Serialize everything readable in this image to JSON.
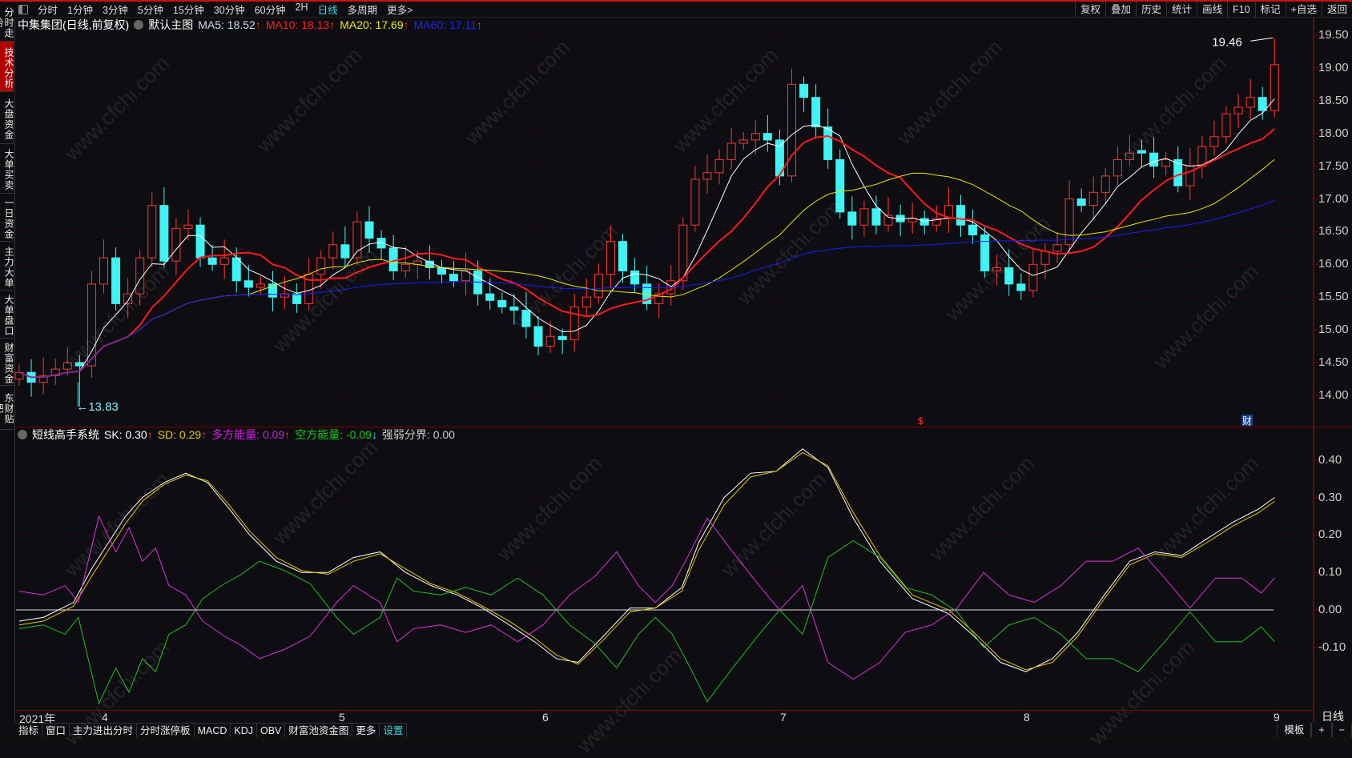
{
  "sidebar": {
    "items": [
      "分时走势",
      "技术分析",
      "大盘资金",
      "大单买卖",
      "一日资金",
      "主力大单",
      "大单盘口",
      "财富资金",
      "东财贴吧"
    ],
    "active": 1
  },
  "toolbar": {
    "periods": [
      "分时",
      "1分钟",
      "3分钟",
      "5分钟",
      "15分钟",
      "30分钟",
      "60分钟",
      "2H",
      "日线",
      "多周期",
      "更多>"
    ],
    "active": "日线",
    "right": [
      "复权",
      "叠加",
      "历史",
      "统计",
      "画线",
      "F10",
      "标记",
      "+自选",
      "返回"
    ]
  },
  "info": {
    "stock": "中集集团(日线,前复权)",
    "template": "默认主图",
    "ma5": "MA5: 18.52",
    "ma10": "MA10: 18.13",
    "ma20": "MA20: 17.69",
    "ma60": "MA60: 17.11",
    "arrow_up": "↑"
  },
  "indicator": {
    "name": "短线高手系统",
    "sk": "SK: 0.30",
    "sd": "SD: 0.29",
    "bull": "多方能量: 0.09",
    "bear": "空方能量: -0.09",
    "line": "强弱分界: 0.00",
    "up": "↑",
    "down": "↓"
  },
  "markers": {
    "high": "19.46",
    "low": "13.83",
    "dollar": "$",
    "cai": "财"
  },
  "watermark": "www.cfchi.com",
  "dates": {
    "year": "2021年",
    "months": [
      "4",
      "5",
      "6",
      "7",
      "8",
      "9"
    ]
  },
  "period_box": "日线",
  "bottom_tabs": [
    "指标",
    "窗口",
    "主力进出分时",
    "分时涨停板",
    "MACD",
    "KDJ",
    "OBV",
    "财富池资金图",
    "更多",
    "设置"
  ],
  "bottom_right": [
    "模板",
    "+",
    "−"
  ],
  "colors": {
    "up": "#ff3333",
    "down": "#3ef4f4",
    "ma5": "#ffffff",
    "ma10": "#ff1a1a",
    "ma20": "#e6e600",
    "ma60": "#1a1aff",
    "sk": "#ffffff",
    "sd": "#e6c800",
    "bull": "#e030e0",
    "bear": "#20c020"
  },
  "chart_data": [
    {
      "type": "candlestick",
      "title": "中集集团 日线",
      "ylim": [
        13.8,
        19.6
      ],
      "yticks": [
        "19.50",
        "19.00",
        "18.50",
        "18.00",
        "17.50",
        "17.00",
        "16.50",
        "16.00",
        "15.50",
        "15.00",
        "14.50",
        "14.00"
      ],
      "first_open": 14.25,
      "high_value": 19.46,
      "low_value": 13.83,
      "close": [
        14.35,
        14.2,
        14.3,
        14.4,
        14.5,
        14.45,
        15.7,
        16.1,
        15.4,
        15.55,
        16.1,
        16.9,
        16.05,
        16.55,
        16.6,
        16.1,
        16.0,
        16.1,
        15.75,
        15.65,
        15.7,
        15.5,
        15.55,
        15.4,
        15.85,
        16.1,
        16.3,
        16.1,
        16.65,
        16.4,
        16.25,
        15.9,
        16.0,
        16.05,
        15.95,
        15.85,
        15.75,
        15.9,
        15.55,
        15.45,
        15.35,
        15.3,
        15.05,
        14.75,
        14.9,
        14.85,
        15.35,
        15.5,
        15.85,
        16.35,
        15.9,
        15.7,
        15.4,
        15.55,
        15.75,
        16.6,
        17.3,
        17.4,
        17.6,
        17.85,
        17.9,
        18.0,
        17.9,
        17.35,
        18.75,
        18.55,
        18.1,
        17.6,
        16.8,
        16.6,
        16.85,
        16.6,
        16.75,
        16.65,
        16.7,
        16.6,
        16.7,
        16.9,
        16.6,
        16.45,
        15.9,
        15.95,
        15.7,
        15.6,
        16.0,
        16.2,
        16.3,
        17.0,
        16.9,
        17.1,
        17.35,
        17.6,
        17.7,
        17.7,
        17.5,
        17.6,
        17.2,
        17.5,
        17.8,
        17.95,
        18.3,
        18.4,
        18.55,
        18.35,
        19.05
      ],
      "ma_periods": [
        5,
        10,
        20,
        60
      ]
    },
    {
      "type": "line",
      "title": "短线高手系统",
      "ylim": [
        -0.18,
        0.46
      ],
      "yticks": [
        "0.40",
        "0.30",
        "0.20",
        "0.10",
        "0.00",
        "-0.10"
      ],
      "baseline": 0,
      "series": [
        {
          "name": "SK",
          "points": [
            [
              0,
              -0.03
            ],
            [
              2,
              -0.02
            ],
            [
              4.5,
              0.02
            ],
            [
              6,
              0.11
            ],
            [
              7.4,
              0.18
            ],
            [
              8.8,
              0.25
            ],
            [
              10.2,
              0.3
            ],
            [
              12,
              0.34
            ],
            [
              13.8,
              0.365
            ],
            [
              15.6,
              0.34
            ],
            [
              17.4,
              0.27
            ],
            [
              19.1,
              0.2
            ],
            [
              21.3,
              0.13
            ],
            [
              23.4,
              0.1
            ],
            [
              25.6,
              0.1
            ],
            [
              27.7,
              0.14
            ],
            [
              29.9,
              0.155
            ],
            [
              32,
              0.1
            ],
            [
              34.1,
              0.065
            ],
            [
              36.3,
              0.04
            ],
            [
              38.4,
              0.005
            ],
            [
              40.6,
              -0.04
            ],
            [
              42.7,
              -0.085
            ],
            [
              44.5,
              -0.13
            ],
            [
              46.3,
              -0.14
            ],
            [
              48.4,
              -0.07
            ],
            [
              50.6,
              0.005
            ],
            [
              52.7,
              0.005
            ],
            [
              54.9,
              0.06
            ],
            [
              56.3,
              0.18
            ],
            [
              58.4,
              0.3
            ],
            [
              60.6,
              0.365
            ],
            [
              62.7,
              0.37
            ],
            [
              64.9,
              0.43
            ],
            [
              67,
              0.38
            ],
            [
              69.1,
              0.245
            ],
            [
              71.3,
              0.13
            ],
            [
              74,
              0.03
            ],
            [
              77,
              -0.01
            ],
            [
              79.1,
              -0.07
            ],
            [
              81.3,
              -0.14
            ],
            [
              83.4,
              -0.165
            ],
            [
              85.6,
              -0.13
            ],
            [
              87.7,
              -0.06
            ],
            [
              89.9,
              0.04
            ],
            [
              92,
              0.13
            ],
            [
              94.1,
              0.155
            ],
            [
              96.3,
              0.145
            ],
            [
              98.4,
              0.19
            ],
            [
              100.6,
              0.235
            ],
            [
              102.7,
              0.27
            ],
            [
              104,
              0.3
            ]
          ]
        },
        {
          "name": "SD",
          "points": [
            [
              0,
              -0.04
            ],
            [
              2,
              -0.03
            ],
            [
              4.5,
              0.01
            ],
            [
              6,
              0.09
            ],
            [
              7.4,
              0.16
            ],
            [
              8.8,
              0.23
            ],
            [
              10.2,
              0.29
            ],
            [
              12,
              0.335
            ],
            [
              13.8,
              0.36
            ],
            [
              15.6,
              0.345
            ],
            [
              17.4,
              0.28
            ],
            [
              19.1,
              0.21
            ],
            [
              21.3,
              0.14
            ],
            [
              23.4,
              0.105
            ],
            [
              25.6,
              0.095
            ],
            [
              27.7,
              0.13
            ],
            [
              29.9,
              0.15
            ],
            [
              32,
              0.11
            ],
            [
              34.1,
              0.07
            ],
            [
              36.3,
              0.045
            ],
            [
              38.4,
              0.01
            ],
            [
              40.6,
              -0.03
            ],
            [
              42.7,
              -0.075
            ],
            [
              44.5,
              -0.12
            ],
            [
              46.3,
              -0.145
            ],
            [
              48.4,
              -0.08
            ],
            [
              50.6,
              -0.005
            ],
            [
              52.7,
              0.005
            ],
            [
              54.9,
              0.05
            ],
            [
              56.3,
              0.16
            ],
            [
              58.4,
              0.28
            ],
            [
              60.6,
              0.355
            ],
            [
              62.7,
              0.37
            ],
            [
              64.9,
              0.42
            ],
            [
              67,
              0.385
            ],
            [
              69.1,
              0.26
            ],
            [
              71.3,
              0.145
            ],
            [
              74,
              0.04
            ],
            [
              77,
              0.0
            ],
            [
              79.1,
              -0.06
            ],
            [
              81.3,
              -0.13
            ],
            [
              83.4,
              -0.16
            ],
            [
              85.6,
              -0.14
            ],
            [
              87.7,
              -0.07
            ],
            [
              89.9,
              0.03
            ],
            [
              92,
              0.12
            ],
            [
              94.1,
              0.15
            ],
            [
              96.3,
              0.14
            ],
            [
              98.4,
              0.18
            ],
            [
              100.6,
              0.225
            ],
            [
              102.7,
              0.26
            ],
            [
              104,
              0.29
            ]
          ]
        },
        {
          "name": "多方能量",
          "points": [
            [
              0,
              0.05
            ],
            [
              2,
              0.04
            ],
            [
              3.8,
              0.065
            ],
            [
              4.9,
              0.02
            ],
            [
              6.6,
              0.25
            ],
            [
              8,
              0.155
            ],
            [
              9.1,
              0.22
            ],
            [
              10.2,
              0.13
            ],
            [
              11.3,
              0.165
            ],
            [
              12.4,
              0.065
            ],
            [
              13.8,
              0.04
            ],
            [
              15.2,
              -0.03
            ],
            [
              17,
              -0.07
            ],
            [
              18.4,
              -0.095
            ],
            [
              19.9,
              -0.13
            ],
            [
              22,
              -0.105
            ],
            [
              24.1,
              -0.07
            ],
            [
              26.3,
              0.02
            ],
            [
              27.7,
              0.065
            ],
            [
              29.9,
              0.02
            ],
            [
              31.3,
              -0.085
            ],
            [
              32.7,
              -0.05
            ],
            [
              34.9,
              -0.04
            ],
            [
              37,
              -0.06
            ],
            [
              39.1,
              -0.04
            ],
            [
              41.3,
              -0.085
            ],
            [
              43.4,
              -0.04
            ],
            [
              45.6,
              0.04
            ],
            [
              47.7,
              0.09
            ],
            [
              49.5,
              0.155
            ],
            [
              51.3,
              0.065
            ],
            [
              52.7,
              0.02
            ],
            [
              54.1,
              0.065
            ],
            [
              55.6,
              0.155
            ],
            [
              57,
              0.245
            ],
            [
              59.1,
              0.155
            ],
            [
              61.3,
              0.065
            ],
            [
              63,
              0.0
            ],
            [
              64.9,
              0.065
            ],
            [
              67,
              -0.14
            ],
            [
              69.1,
              -0.185
            ],
            [
              71.3,
              -0.14
            ],
            [
              73.4,
              -0.06
            ],
            [
              75.6,
              -0.04
            ],
            [
              77.7,
              0.005
            ],
            [
              79.9,
              0.1
            ],
            [
              82,
              0.04
            ],
            [
              84.1,
              0.02
            ],
            [
              86.3,
              0.065
            ],
            [
              88.4,
              0.13
            ],
            [
              90.6,
              0.13
            ],
            [
              92.7,
              0.165
            ],
            [
              94.9,
              0.085
            ],
            [
              97,
              0.005
            ],
            [
              99.1,
              0.085
            ],
            [
              101.3,
              0.085
            ],
            [
              102.9,
              0.045
            ],
            [
              104,
              0.085
            ]
          ]
        },
        {
          "name": "空方能量",
          "points": [
            [
              0,
              -0.05
            ],
            [
              2,
              -0.04
            ],
            [
              3.8,
              -0.065
            ],
            [
              4.9,
              -0.02
            ],
            [
              6.6,
              -0.25
            ],
            [
              8,
              -0.155
            ],
            [
              9.1,
              -0.22
            ],
            [
              10.2,
              -0.13
            ],
            [
              11.3,
              -0.165
            ],
            [
              12.4,
              -0.065
            ],
            [
              13.8,
              -0.04
            ],
            [
              15.2,
              0.03
            ],
            [
              17,
              0.07
            ],
            [
              18.4,
              0.095
            ],
            [
              19.9,
              0.13
            ],
            [
              22,
              0.105
            ],
            [
              24.1,
              0.07
            ],
            [
              26.3,
              -0.02
            ],
            [
              27.7,
              -0.065
            ],
            [
              29.9,
              -0.02
            ],
            [
              31.3,
              0.085
            ],
            [
              32.7,
              0.05
            ],
            [
              34.9,
              0.04
            ],
            [
              37,
              0.06
            ],
            [
              39.1,
              0.04
            ],
            [
              41.3,
              0.085
            ],
            [
              43.4,
              0.04
            ],
            [
              45.6,
              -0.04
            ],
            [
              47.7,
              -0.09
            ],
            [
              49.5,
              -0.155
            ],
            [
              51.3,
              -0.065
            ],
            [
              52.7,
              -0.02
            ],
            [
              54.1,
              -0.065
            ],
            [
              55.6,
              -0.155
            ],
            [
              57,
              -0.245
            ],
            [
              59.1,
              -0.155
            ],
            [
              61.3,
              -0.065
            ],
            [
              63,
              0.0
            ],
            [
              64.9,
              -0.065
            ],
            [
              67,
              0.14
            ],
            [
              69.1,
              0.185
            ],
            [
              71.3,
              0.14
            ],
            [
              73.4,
              0.06
            ],
            [
              75.6,
              0.04
            ],
            [
              77.7,
              -0.005
            ],
            [
              79.9,
              -0.1
            ],
            [
              82,
              -0.04
            ],
            [
              84.1,
              -0.02
            ],
            [
              86.3,
              -0.065
            ],
            [
              88.4,
              -0.13
            ],
            [
              90.6,
              -0.13
            ],
            [
              92.7,
              -0.165
            ],
            [
              94.9,
              -0.085
            ],
            [
              97,
              -0.005
            ],
            [
              99.1,
              -0.085
            ],
            [
              101.3,
              -0.085
            ],
            [
              102.9,
              -0.045
            ],
            [
              104,
              -0.085
            ]
          ]
        }
      ]
    }
  ]
}
